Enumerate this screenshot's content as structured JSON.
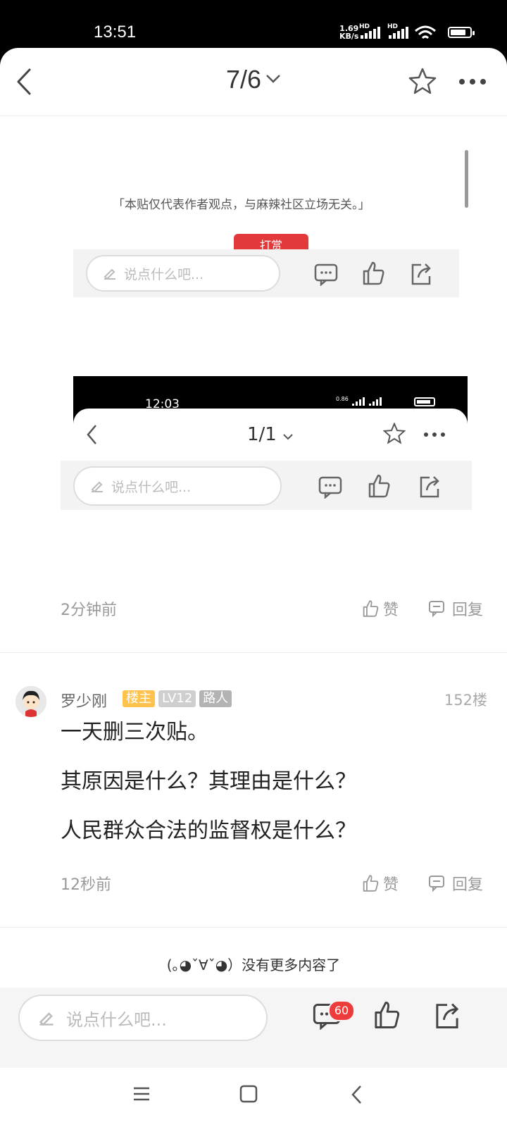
{
  "status_bar": {
    "time": "13:51",
    "net_speed_value": "1.69",
    "net_speed_unit": "KB/s",
    "hd1": "HD",
    "hd2": "HD",
    "battery_level": 0.8
  },
  "header": {
    "page_indicator": "7/6"
  },
  "embedded_screenshot_1": {
    "disclaimer": "「本贴仅代表作者观点，与麻辣社区立场无关。」",
    "tip_button": "打赏",
    "input_placeholder": "说点什么吧..."
  },
  "embedded_screenshot_2": {
    "time": "12:03",
    "net_speed_value": "0.86",
    "page_indicator": "1/1",
    "input_placeholder": "说点什么吧..."
  },
  "post_meta": {
    "time": "2分钟前",
    "like_label": "赞",
    "reply_label": "回复"
  },
  "comment": {
    "author": "罗少刚",
    "badges": [
      "楼主",
      "LV12",
      "路人"
    ],
    "floor": "152楼",
    "lines": [
      "一天删三次贴。",
      "其原因是什么？其理由是什么？",
      "人民群众合法的监督权是什么？"
    ],
    "time": "12秒前",
    "like_label": "赞",
    "reply_label": "回复"
  },
  "end_message": "(｡◕ˇ∀ˇ◕）没有更多内容了",
  "bottom_bar": {
    "input_placeholder": "说点什么吧...",
    "comment_count": "60"
  }
}
